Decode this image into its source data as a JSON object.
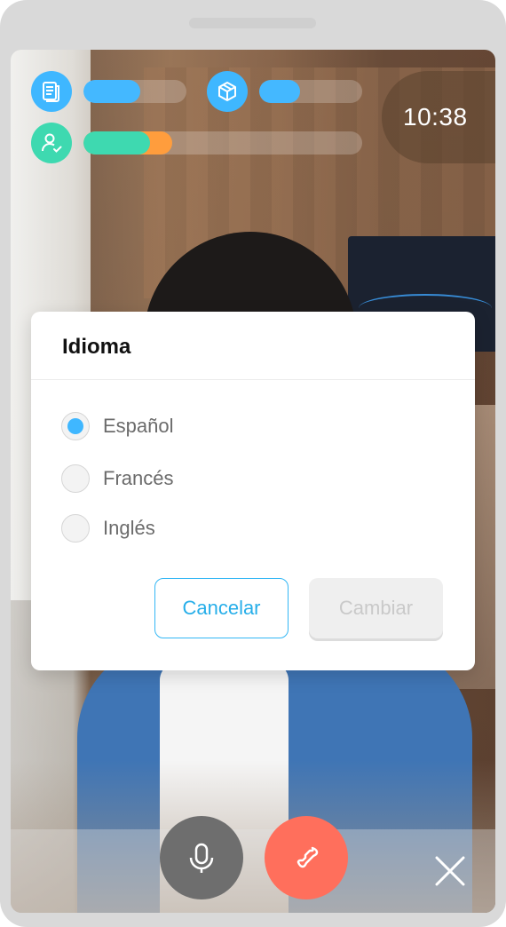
{
  "colors": {
    "accent": "#3fb7ff",
    "stat_bar_blue": "#44b8ff",
    "stat_bar_green": "#3ed9b0",
    "stat_bar_orange": "#ff9d3d",
    "end_call": "#ff6f5c",
    "mic_button": "#6e6e6e"
  },
  "stats": {
    "documents": {
      "icon": "document-icon",
      "progress": 0.55
    },
    "packages": {
      "icon": "package-icon",
      "progress": 0.4
    },
    "user": {
      "icon": "user-check-icon",
      "progress_green": 0.24,
      "progress_orange": 0.08
    }
  },
  "timer": {
    "value": "10:38"
  },
  "dialog": {
    "title": "Idioma",
    "options": [
      {
        "label": "Español",
        "selected": true
      },
      {
        "label": "Francés",
        "selected": false
      },
      {
        "label": "Inglés",
        "selected": false
      }
    ],
    "cancel_label": "Cancelar",
    "change_label": "Cambiar"
  },
  "controls": {
    "mic": {
      "icon": "microphone-icon"
    },
    "end_call": {
      "icon": "phone-hangup-icon"
    },
    "close": {
      "icon": "close-icon"
    }
  }
}
